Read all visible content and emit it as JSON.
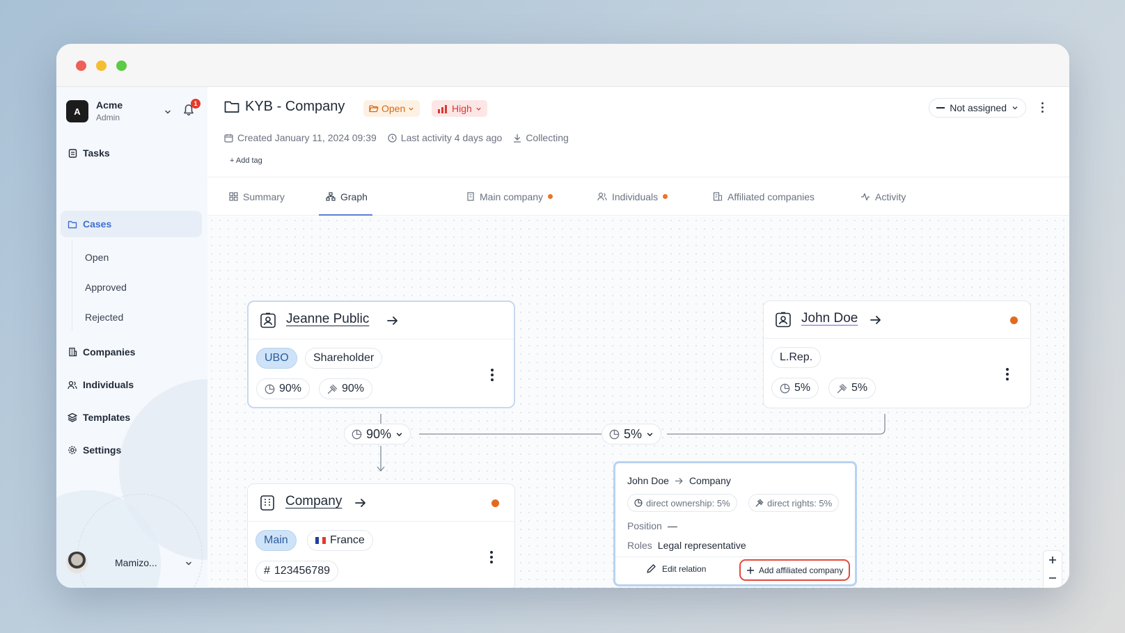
{
  "org": {
    "avatar_letter": "A",
    "name": "Acme",
    "role": "Admin",
    "notifications": "1"
  },
  "nav": {
    "tasks": "Tasks",
    "cases": "Cases",
    "cases_sub": [
      "Open",
      "Approved",
      "Rejected"
    ],
    "companies": "Companies",
    "individuals": "Individuals",
    "templates": "Templates",
    "settings": "Settings"
  },
  "user": {
    "name": "Mamizo..."
  },
  "header": {
    "title": "KYB - Company",
    "status": "Open",
    "risk": "High",
    "created": "Created January 11, 2024 09:39",
    "last_activity": "Last activity 4 days ago",
    "state": "Collecting",
    "add_tag": "Add tag",
    "assignee": "Not assigned"
  },
  "tabs": [
    {
      "label": "Summary",
      "dot": false
    },
    {
      "label": "Graph",
      "dot": false,
      "active": true
    },
    {
      "label": "Main company",
      "dot": true
    },
    {
      "label": "Individuals",
      "dot": true
    },
    {
      "label": "Affiliated companies",
      "dot": false
    },
    {
      "label": "Activity",
      "dot": false
    }
  ],
  "graph": {
    "jeanne": {
      "name": "Jeanne Public",
      "tag1": "UBO",
      "tag2": "Shareholder",
      "ownership": "90%",
      "rights": "90%"
    },
    "john": {
      "name": "John Doe",
      "tag1": "L.Rep.",
      "ownership": "5%",
      "rights": "5%"
    },
    "company": {
      "name": "Company",
      "tag1": "Main",
      "country": "France",
      "country_flag": "🇫🇷",
      "reg_number": "123456789"
    },
    "edge_jeanne": "90%",
    "edge_john": "5%",
    "relation": {
      "from": "John Doe",
      "to": "Company",
      "direct_ownership": "direct ownership: 5%",
      "direct_rights": "direct rights: 5%",
      "position_label": "Position",
      "position_value": "—",
      "roles_label": "Roles",
      "roles_value": "Legal representative",
      "edit_label": "Edit relation",
      "add_label": "Add affiliated company"
    }
  },
  "colors": {
    "accent": "#5a7ed6",
    "status_open": "#d9690f",
    "risk_high": "#d93a31",
    "dot_orange": "#e2691f"
  }
}
